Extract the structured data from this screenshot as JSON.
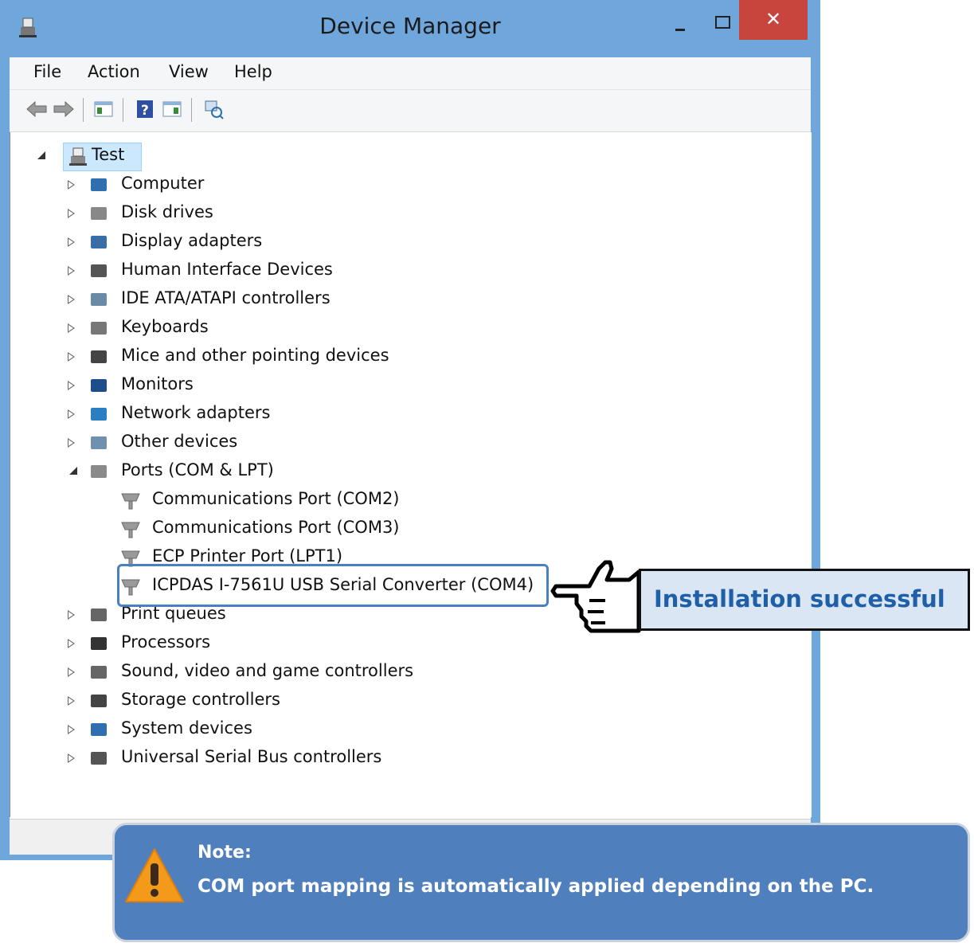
{
  "window": {
    "title": "Device Manager",
    "close_label": "✕"
  },
  "menu": {
    "items": [
      "File",
      "Action",
      "View",
      "Help"
    ]
  },
  "tree": {
    "root": "Test",
    "categories": [
      "Computer",
      "Disk drives",
      "Display adapters",
      "Human Interface Devices",
      "IDE ATA/ATAPI controllers",
      "Keyboards",
      "Mice and other pointing devices",
      "Monitors",
      "Network adapters",
      "Other devices",
      "Ports (COM & LPT)",
      "Print queues",
      "Processors",
      "Sound, video and game controllers",
      "Storage controllers",
      "System devices",
      "Universal Serial Bus controllers"
    ],
    "ports_children": [
      "Communications Port (COM2)",
      "Communications Port (COM3)",
      "ECP Printer Port (LPT1)",
      "ICPDAS I-7561U USB Serial Converter (COM4)"
    ]
  },
  "callout": {
    "text": "Installation successful"
  },
  "note": {
    "title": "Note:",
    "text": "COM port mapping is automatically applied depending on the PC."
  },
  "colors": {
    "titlebar": "#6fa6dc",
    "close": "#c7453d",
    "note_bg": "#4f80bd",
    "callout_text": "#1f5fa8",
    "highlight": "#4a7fc1"
  }
}
